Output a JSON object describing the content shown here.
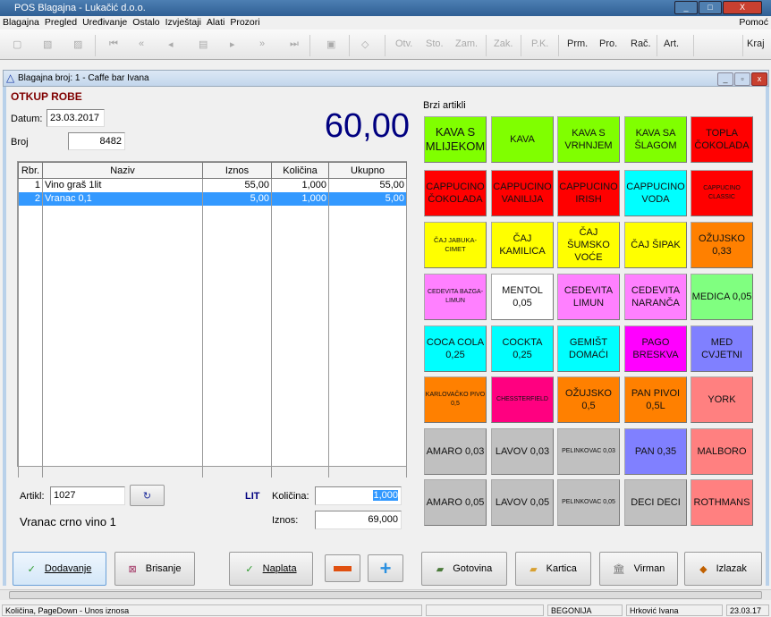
{
  "app": {
    "title": "POS Blagajna - Lukačić d.o.o."
  },
  "menu": [
    "Blagajna",
    "Pregled",
    "Uređivanje",
    "Ostalo",
    "Izvještaji",
    "Alati",
    "Prozori"
  ],
  "menu_help": "Pomoć",
  "toolbar": {
    "disabled": [
      "Otv.",
      "Sto.",
      "Zam.",
      "Zak.",
      "P.K."
    ],
    "enabled": [
      "Prm.",
      "Pro.",
      "Rač.",
      "Art."
    ],
    "exit": "Kraj"
  },
  "child": {
    "title": "Blagajna broj: 1 - Caffe bar Ivana"
  },
  "form": {
    "heading": "OTKUP ROBE",
    "date_label": "Datum:",
    "date": "23.03.2017",
    "broj_label": "Broj",
    "broj": "8482",
    "total": "60,00"
  },
  "table": {
    "headers": [
      "Rbr.",
      "Naziv",
      "Iznos",
      "Količina",
      "Ukupno"
    ],
    "rows": [
      [
        "1",
        "Vino graš 1lit",
        "55,00",
        "1,000",
        "55,00"
      ],
      [
        "2",
        "Vranac 0,1",
        "5,00",
        "1,000",
        "5,00"
      ]
    ],
    "selected": 1
  },
  "entry": {
    "artikl_label": "Artikl:",
    "artikl": "1027",
    "unit": "LIT",
    "kolicina_label": "Količina:",
    "kolicina": "1,000",
    "iznos_label": "Iznos:",
    "iznos": "69,000",
    "description": "Vranac crno vino 1"
  },
  "quick": {
    "title": "Brzi artikli",
    "items": [
      {
        "l": "KAVA S MLIJEKOM",
        "c": "#80ff00",
        "s": 13
      },
      {
        "l": "KAVA",
        "c": "#80ff00",
        "s": 11
      },
      {
        "l": "KAVA S VRHNJEM",
        "c": "#80ff00",
        "s": 11
      },
      {
        "l": "KAVA SA ŠLAGOM",
        "c": "#80ff00",
        "s": 11
      },
      {
        "l": "TOPLA ČOKOLADA",
        "c": "#ff0000",
        "s": 11
      },
      {
        "l": "CAPPUCINO ČOKOLADA",
        "c": "#ff0000",
        "s": 11
      },
      {
        "l": "CAPPUCINO VANILIJA",
        "c": "#ff0000",
        "s": 11
      },
      {
        "l": "CAPPUCINO IRISH",
        "c": "#ff0000",
        "s": 11
      },
      {
        "l": "CAPPUCINO VODA",
        "c": "#00ffff",
        "s": 11
      },
      {
        "l": "CAPPUCINO CLASSIC",
        "c": "#ff0000",
        "s": 7
      },
      {
        "l": "ČAJ JABUKA-CIMET",
        "c": "#ffff00",
        "s": 7.5
      },
      {
        "l": "ČAJ KAMILICA",
        "c": "#ffff00",
        "s": 11
      },
      {
        "l": "ČAJ ŠUMSKO VOĆE",
        "c": "#ffff00",
        "s": 11
      },
      {
        "l": "ČAJ ŠIPAK",
        "c": "#ffff00",
        "s": 11
      },
      {
        "l": "OŽUJSKO 0,33",
        "c": "#ff8000",
        "s": 11
      },
      {
        "l": "CEDEVITA BAZGA-LIMUN",
        "c": "#ff80ff",
        "s": 7
      },
      {
        "l": "MENTOL 0,05",
        "c": "#ffffff",
        "s": 11
      },
      {
        "l": "CEDEVITA LIMUN",
        "c": "#ff80ff",
        "s": 11
      },
      {
        "l": "CEDEVITA NARANČA",
        "c": "#ff80ff",
        "s": 11
      },
      {
        "l": "MEDICA 0,05",
        "c": "#80ff80",
        "s": 11
      },
      {
        "l": "COCA COLA 0,25",
        "c": "#00ffff",
        "s": 11
      },
      {
        "l": "COCKTA 0,25",
        "c": "#00ffff",
        "s": 11
      },
      {
        "l": "GEMIŠT DOMAĆI",
        "c": "#00ffff",
        "s": 11
      },
      {
        "l": "PAGO BRESKVA",
        "c": "#ff00ff",
        "s": 11
      },
      {
        "l": "MED CVJETNI",
        "c": "#8080ff",
        "s": 11
      },
      {
        "l": "KARLOVAČKO PIVO 0,5",
        "c": "#ff8000",
        "s": 7
      },
      {
        "l": "CHESSTERFIELD",
        "c": "#ff0080",
        "s": 7
      },
      {
        "l": "OŽUJSKO 0,5",
        "c": "#ff8000",
        "s": 11
      },
      {
        "l": "PAN PIVOI 0,5L",
        "c": "#ff8000",
        "s": 11
      },
      {
        "l": "YORK",
        "c": "#ff8080",
        "s": 11
      },
      {
        "l": "AMARO 0,03",
        "c": "#c0c0c0",
        "s": 11
      },
      {
        "l": "LAVOV 0,03",
        "c": "#c0c0c0",
        "s": 11
      },
      {
        "l": "PELINKOVAC 0,03",
        "c": "#c0c0c0",
        "s": 7
      },
      {
        "l": "PAN 0,35",
        "c": "#8080ff",
        "s": 11
      },
      {
        "l": "MALBORO",
        "c": "#ff8080",
        "s": 11
      },
      {
        "l": "AMARO 0,05",
        "c": "#c0c0c0",
        "s": 11
      },
      {
        "l": "LAVOV 0,05",
        "c": "#c0c0c0",
        "s": 11
      },
      {
        "l": "PELINKOVAC 0,05",
        "c": "#c0c0c0",
        "s": 7
      },
      {
        "l": "DECI DECI",
        "c": "#c0c0c0",
        "s": 11
      },
      {
        "l": "ROTHMANS",
        "c": "#ff8080",
        "s": 11
      }
    ]
  },
  "buttons": {
    "add": "Dodavanje",
    "delete": "Brisanje",
    "pay": "Naplata",
    "cash": "Gotovina",
    "card": "Kartica",
    "transfer": "Virman",
    "exit": "Izlazak"
  },
  "status": {
    "hint": "Količina, PageDown - Unos iznosa",
    "location": "BEGONIJA",
    "user": "Hrković Ivana",
    "date": "23.03.17"
  }
}
